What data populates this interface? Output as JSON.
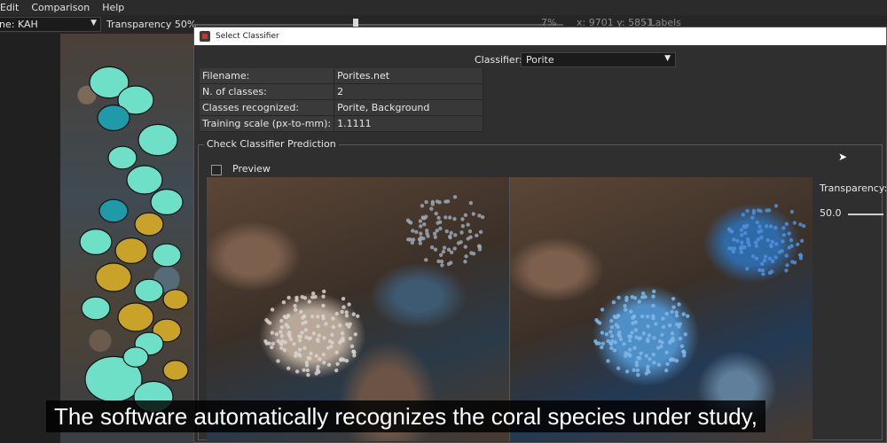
{
  "menubar": {
    "items": [
      "Edit",
      "Comparison",
      "Help"
    ]
  },
  "toolbar": {
    "scene_combo_value": "ne: KAH",
    "transparency_label": "Transparency 50%",
    "zoom_readout": "7%",
    "coord_readout": "x: 9701 y: 5851",
    "labels_readout": "- Labels"
  },
  "dialog": {
    "title": "Select Classifier",
    "classifier_label": "Classifier:",
    "classifier_value": "Porite",
    "info": [
      {
        "key": "Filename:",
        "value": "Porites.net"
      },
      {
        "key": "N. of classes:",
        "value": "2"
      },
      {
        "key": "Classes recognized:",
        "value": "Porite, Background"
      },
      {
        "key": "Training scale (px-to-mm):",
        "value": "1.1111"
      }
    ],
    "group_title": "Check Classifier Prediction",
    "preview_label": "Preview",
    "transparency_label": "Transparency:",
    "transparency_value": "50.0"
  },
  "subtitle": "The software automatically recognizes the coral species under study,",
  "colors": {
    "dialog_bg": "#2f2f2f",
    "titlebar_bg": "#ffffff",
    "label_cyan": "#6fe0c8",
    "label_teal": "#1e9aa8",
    "label_gold": "#c9a22a",
    "prediction_blue": "#4f8fc8"
  }
}
